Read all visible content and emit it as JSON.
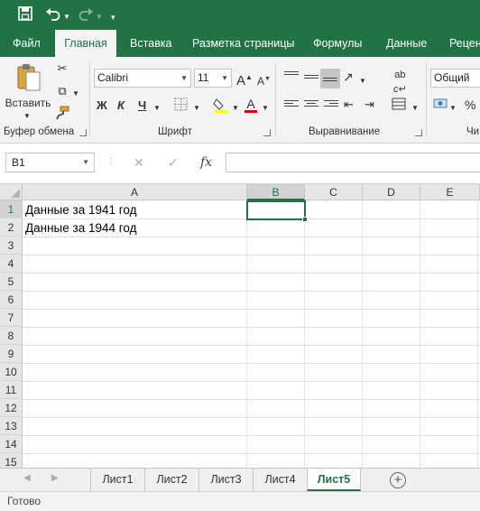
{
  "quick_access": {
    "save_icon": "save-icon",
    "undo_icon": "undo-icon",
    "redo_icon": "redo-icon",
    "customize_icon": "customize-quick-access-icon"
  },
  "tabs": [
    "Файл",
    "Главная",
    "Вставка",
    "Разметка страницы",
    "Формулы",
    "Данные",
    "Рецен"
  ],
  "active_tab": "Главная",
  "ribbon": {
    "clipboard": {
      "paste_label": "Вставить",
      "group_label": "Буфер обмена"
    },
    "font": {
      "font_name": "Calibri",
      "font_size": "11",
      "bold": "Ж",
      "italic": "К",
      "underline": "Ч",
      "grow": "A",
      "shrink": "A",
      "group_label": "Шрифт"
    },
    "alignment": {
      "group_label": "Выравнивание"
    },
    "number": {
      "format": "Общий",
      "group_label": "Чи"
    }
  },
  "formula_bar": {
    "name_box": "B1",
    "cancel": "✕",
    "enter": "✓",
    "fx": "fx",
    "value": ""
  },
  "grid": {
    "columns": [
      "A",
      "B",
      "C",
      "D",
      "E"
    ],
    "selected_column": "B",
    "rows": [
      "1",
      "2",
      "3",
      "4",
      "5",
      "6",
      "7",
      "8",
      "9",
      "10",
      "11",
      "12",
      "13",
      "14",
      "15"
    ],
    "cells": {
      "A1": "Данные за 1941 год",
      "A2": "Данные за 1944 год"
    },
    "active_cell": "B1"
  },
  "sheets": [
    "Лист1",
    "Лист2",
    "Лист3",
    "Лист4",
    "Лист5"
  ],
  "active_sheet": "Лист5",
  "status": "Готово",
  "colors": {
    "brand": "#217346"
  }
}
